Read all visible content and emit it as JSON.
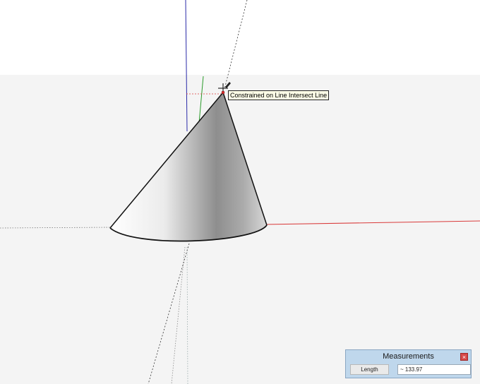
{
  "tooltip": {
    "text": "Constrained on Line Intersect Line"
  },
  "measurements": {
    "title": "Measurements",
    "close_glyph": "×",
    "label": "Length",
    "value": "~ 133.97"
  },
  "colors": {
    "sky": "#ffffff",
    "ground": "#f4f4f4",
    "red_axis": "#d93a3a",
    "green_axis": "#2a9b2a",
    "blue_axis": "#2a2aa8",
    "inference_point": "#e03030"
  },
  "icons": {
    "cursor": "pencil-cursor-icon",
    "close": "close-icon"
  }
}
